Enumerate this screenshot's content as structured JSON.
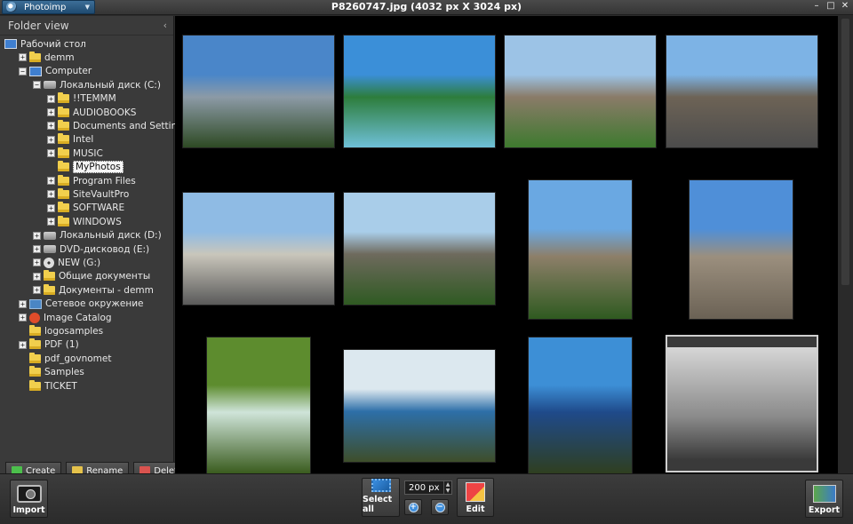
{
  "window": {
    "app_name": "Photoimp",
    "title": "P8260747.jpg (4032 px X 3024 px)",
    "controls": [
      "–",
      "□",
      "✕"
    ]
  },
  "sidebar": {
    "title": "Folder view",
    "tree": [
      {
        "label": "Рабочий стол",
        "icon": "desktop-icon",
        "level": 0,
        "expander": ""
      },
      {
        "label": "demm",
        "icon": "folder-icon",
        "level": 1,
        "expander": "+"
      },
      {
        "label": "Computer",
        "icon": "computer-icon",
        "level": 1,
        "expander": "−"
      },
      {
        "label": "Локальный диск (C:)",
        "icon": "drive-icon",
        "level": 2,
        "expander": "−"
      },
      {
        "label": "!!TEMMM",
        "icon": "folder-icon",
        "level": 3,
        "expander": "+"
      },
      {
        "label": "AUDIOBOOKS",
        "icon": "folder-icon",
        "level": 3,
        "expander": "+"
      },
      {
        "label": "Documents and Settings",
        "icon": "folder-icon",
        "level": 3,
        "expander": "+"
      },
      {
        "label": "Intel",
        "icon": "folder-icon",
        "level": 3,
        "expander": "+"
      },
      {
        "label": "MUSIC",
        "icon": "folder-icon",
        "level": 3,
        "expander": "+"
      },
      {
        "label": "MyPhotos",
        "icon": "folder-icon",
        "level": 3,
        "expander": "",
        "selected": true
      },
      {
        "label": "Program Files",
        "icon": "folder-icon",
        "level": 3,
        "expander": "+"
      },
      {
        "label": "SiteVaultPro",
        "icon": "folder-icon",
        "level": 3,
        "expander": "+"
      },
      {
        "label": "SOFTWARE",
        "icon": "folder-icon",
        "level": 3,
        "expander": "+"
      },
      {
        "label": "WINDOWS",
        "icon": "folder-icon",
        "level": 3,
        "expander": "+"
      },
      {
        "label": "Локальный диск (D:)",
        "icon": "drive-icon",
        "level": 2,
        "expander": "+"
      },
      {
        "label": "DVD-дисковод (E:)",
        "icon": "drive-icon",
        "level": 2,
        "expander": "+"
      },
      {
        "label": "NEW (G:)",
        "icon": "disc-icon",
        "level": 2,
        "expander": "+"
      },
      {
        "label": "Общие документы",
        "icon": "folder-icon",
        "level": 2,
        "expander": "+"
      },
      {
        "label": "Документы - demm",
        "icon": "folder-icon",
        "level": 2,
        "expander": "+"
      },
      {
        "label": "Сетевое окружение",
        "icon": "network-icon",
        "level": 1,
        "expander": "+"
      },
      {
        "label": "Image Catalog",
        "icon": "catalog-icon",
        "level": 1,
        "expander": "+"
      },
      {
        "label": "logosamples",
        "icon": "folder-icon",
        "level": 1,
        "expander": ""
      },
      {
        "label": "PDF (1)",
        "icon": "folder-icon",
        "level": 1,
        "expander": "+"
      },
      {
        "label": "pdf_govnomet",
        "icon": "folder-icon",
        "level": 1,
        "expander": ""
      },
      {
        "label": "Samples",
        "icon": "folder-icon",
        "level": 1,
        "expander": ""
      },
      {
        "label": "TICKET",
        "icon": "folder-icon",
        "level": 1,
        "expander": ""
      }
    ],
    "buttons": {
      "create": "Create",
      "rename": "Rename",
      "delete": "Delete"
    }
  },
  "gallery": {
    "thumbnails": [
      {
        "subject": "mountain-forest",
        "palette": [
          "#4a86c9",
          "#8c9aa6",
          "#2e4a24"
        ]
      },
      {
        "subject": "mountain-lake",
        "palette": [
          "#3b8fd8",
          "#2d7d3c",
          "#6fc0d8"
        ]
      },
      {
        "subject": "royal-palace",
        "palette": [
          "#9cc3e6",
          "#8a7b68",
          "#3e7a2f"
        ]
      },
      {
        "subject": "gothic-cathedral-square",
        "palette": [
          "#7db3e5",
          "#6d6356",
          "#4c4c4c"
        ]
      },
      {
        "subject": "parliament-building",
        "palette": [
          "#8fbbe4",
          "#c9c6bb",
          "#5a5a5a"
        ]
      },
      {
        "subject": "city-hall-trees",
        "palette": [
          "#a9cde9",
          "#6e6a5d",
          "#2f5a22"
        ]
      },
      {
        "subject": "church-spire-trees",
        "palette": [
          "#6aa8e2",
          "#8d7f69",
          "#2f5a20"
        ]
      },
      {
        "subject": "gothic-facade",
        "palette": [
          "#4f8fd8",
          "#9b8f7e",
          "#6b6255"
        ]
      },
      {
        "subject": "waterfall",
        "palette": [
          "#5d8c2e",
          "#cfe4d9",
          "#3a5c1e"
        ]
      },
      {
        "subject": "sea-pine",
        "palette": [
          "#dce8ef",
          "#2d6fa8",
          "#3e4e2a"
        ]
      },
      {
        "subject": "pine-coast",
        "palette": [
          "#3d8fd6",
          "#1f4a8a",
          "#2f3f20"
        ]
      },
      {
        "subject": "hiker-summit",
        "palette": [
          "#d6d6d6",
          "#8a8a8a",
          "#3a3a3a"
        ]
      }
    ]
  },
  "toolbar": {
    "import_label": "Import",
    "select_all_label": "Select all",
    "zoom_value": "200 px",
    "edit_label": "Edit",
    "export_label": "Export"
  }
}
